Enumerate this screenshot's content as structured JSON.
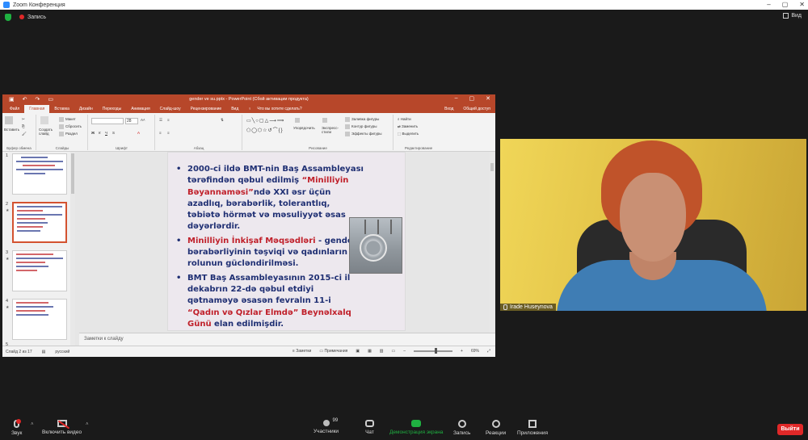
{
  "zoom": {
    "window_title": "Zoom Конференция",
    "recording_label": "Запись",
    "view_label": "Вид",
    "leave_label": "Выйти",
    "participants_count": "99",
    "toolbar": {
      "audio": "Звук",
      "video": "Включить видео",
      "participants": "Участники",
      "chat": "Чат",
      "share": "Демонстрация экрана",
      "record": "Запись",
      "reactions": "Реакции",
      "apps": "Приложения"
    },
    "speaker_name": "Irade Huseynova",
    "colors": {
      "share_green": "#1fb141",
      "leave_red": "#e02828",
      "ppt_red": "#b7472a"
    }
  },
  "ppt": {
    "window_title": "gender ve su.pptx - PowerPoint (Сбой активации продукта)",
    "tabs": [
      "Файл",
      "Главная",
      "Вставка",
      "Дизайн",
      "Переходы",
      "Анимация",
      "Слайд-шоу",
      "Рецензирование",
      "Вид"
    ],
    "active_tab": "Главная",
    "tell_me": "Что вы хотите сделать?",
    "sign_in": "Вход",
    "share": "Общий доступ",
    "ribbon": {
      "clipboard": "Буфер обмена",
      "paste": "Вставить",
      "slides": "Слайды",
      "new_slide": "Создать слайд",
      "layout": "Макет",
      "reset": "Сбросить",
      "section": "Раздел",
      "font": "Шрифт",
      "font_size": "28",
      "paragraph": "Абзац",
      "drawing": "Рисование",
      "arrange": "Упорядочить",
      "quick_styles": "Экспресс-стили",
      "shape_fill": "Заливка фигуры",
      "shape_outline": "Контур фигуры",
      "shape_effects": "Эффекты фигуры",
      "editing": "Редактирование",
      "find": "Найти",
      "replace": "Заменить",
      "select": "Выделить"
    },
    "slide": {
      "b1_a": "2000-ci ildə BMT-nin Baş Assambleyası tərəfindən qəbul edilmiş ",
      "b1_red": "“Minilliyin Bəyannaməsi”",
      "b1_b": "ndə XXI əsr üçün azadlıq, bərabərlik, tolerantlıq, təbiətə hörmət və məsuliyyət əsas dəyərlərdir.",
      "b2_red": "Minilliyin İnkişaf Məqsədləri",
      "b2_b": " - gender bərabərliyinin təşviqi və qadınların rolunun gücləndirilməsi.",
      "b3_a": "BMT Baş Assambleyasının 2015-ci il dekabrın 22-də qəbul etdiyi qətnaməyə əsasən fevralın 11-i ",
      "b3_red": "“Qadın və Qızlar Elmdə” Beynəlxalq Günü",
      "b3_b": " elan edilmişdir."
    },
    "thumb_numbers": [
      "1",
      "2",
      "3",
      "4",
      "5"
    ],
    "notes_placeholder": "Заметки к слайду",
    "status": {
      "slide_of": "Слайд 2 из 17",
      "language": "русский",
      "notes": "Заметки",
      "comments": "Примечания",
      "zoom": "69%"
    }
  }
}
